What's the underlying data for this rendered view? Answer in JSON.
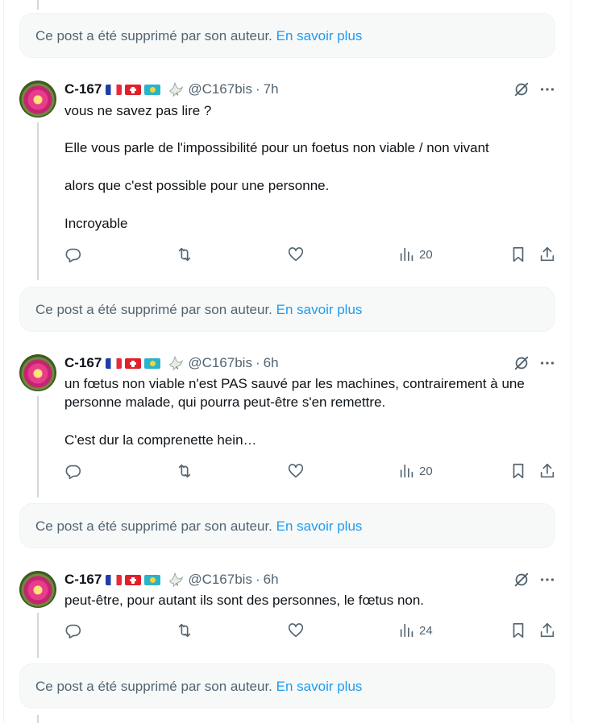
{
  "deleted_notice": {
    "text": "Ce post a été supprimé par son auteur.",
    "link": "En savoir plus"
  },
  "posts": [
    {
      "name": "C-167",
      "handle": "@C167bis",
      "separator": "·",
      "time": "7h",
      "paragraphs": [
        "vous ne savez pas lire ?",
        "Elle vous parle de l'impossibilité pour un foetus non viable / non vivant",
        "alors que c'est possible pour une personne.",
        "Incroyable"
      ],
      "views": "20"
    },
    {
      "name": "C-167",
      "handle": "@C167bis",
      "separator": "·",
      "time": "6h",
      "paragraphs": [
        "un fœtus non viable n'est PAS sauvé par les machines, contrairement à une personne malade, qui pourra peut-être s'en remettre.",
        "C'est dur la comprenette hein…"
      ],
      "views": "20"
    },
    {
      "name": "C-167",
      "handle": "@C167bis",
      "separator": "·",
      "time": "6h",
      "paragraphs": [
        "peut-être, pour autant ils sont des personnes, le fœtus non."
      ],
      "views": "24"
    }
  ],
  "icons": {
    "flags": [
      "flag-france",
      "flag-switzerland",
      "flag-kazakhstan"
    ],
    "badge": "dove-icon",
    "grok": "grok-icon",
    "more": "more-icon",
    "actions": [
      "reply-icon",
      "repost-icon",
      "like-icon",
      "views-icon",
      "bookmark-icon",
      "share-icon"
    ]
  },
  "colors": {
    "link": "#1d9bf0",
    "secondary_text": "#536471",
    "primary_text": "#0f1419",
    "thread_line": "#cfd9de",
    "deleted_bg": "#f7f9f9"
  }
}
